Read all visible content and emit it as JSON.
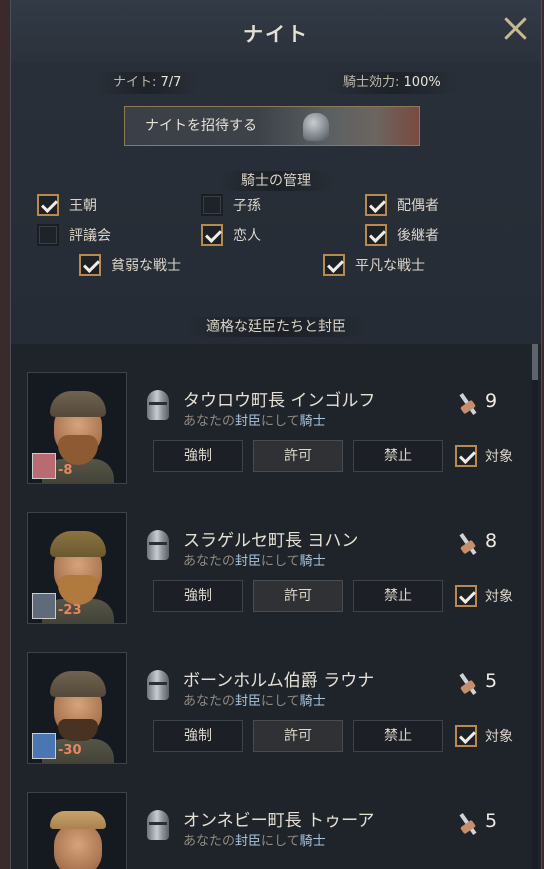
{
  "window": {
    "title": "ナイト"
  },
  "stats": {
    "knights_label": "ナイト:",
    "knights_value": "7/7",
    "effect_label": "騎士効力:",
    "effect_value": "100%"
  },
  "invite_button": "ナイトを招待する",
  "management": {
    "title": "騎士の管理",
    "options": [
      {
        "label": "王朝",
        "checked": true
      },
      {
        "label": "子孫",
        "checked": false
      },
      {
        "label": "配偶者",
        "checked": true
      },
      {
        "label": "評議会",
        "checked": false
      },
      {
        "label": "恋人",
        "checked": true
      },
      {
        "label": "後継者",
        "checked": true
      },
      {
        "label": "貧弱な戦士",
        "checked": true
      },
      {
        "label": "平凡な戦士",
        "checked": true
      }
    ]
  },
  "list_title": "適格な廷臣たちと封臣",
  "candidates": [
    {
      "name": "タウロウ町長 インゴルフ",
      "sub_pre": "あなたの",
      "sub_vassal": "封臣",
      "sub_mid": "にして",
      "sub_knight": "騎士",
      "prowess": "9",
      "opinion": "-8",
      "coa_color": "#b86b70"
    },
    {
      "name": "スラゲルセ町長 ヨハン",
      "sub_pre": "あなたの",
      "sub_vassal": "封臣",
      "sub_mid": "にして",
      "sub_knight": "騎士",
      "prowess": "8",
      "opinion": "-23",
      "coa_color": "#5f6a7a"
    },
    {
      "name": "ボーンホルム伯爵 ラウナ",
      "sub_pre": "あなたの",
      "sub_vassal": "封臣",
      "sub_mid": "にして",
      "sub_knight": "騎士",
      "prowess": "5",
      "opinion": "-30",
      "coa_color": "#4a77b3"
    },
    {
      "name": "オンネビー町長 トゥーア",
      "sub_pre": "あなたの",
      "sub_vassal": "封臣",
      "sub_mid": "にして",
      "sub_knight": "騎士",
      "prowess": "5"
    }
  ],
  "row_buttons": {
    "force": "強制",
    "allow": "許可",
    "forbid": "禁止",
    "target": "対象"
  },
  "colors": {
    "accent": "#b98a4e",
    "panel": "#262c35",
    "link": "#a8c4de",
    "opinion_negative": "#e8875e"
  }
}
